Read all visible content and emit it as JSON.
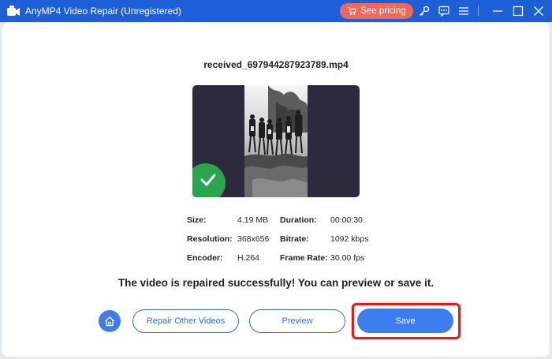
{
  "window": {
    "title": "AnyMP4 Video Repair (Unregistered)",
    "pricing_label": "See pricing"
  },
  "file": {
    "name": "received_697944287923789.mp4"
  },
  "info": {
    "size_label": "Size:",
    "size_value": "4.19 MB",
    "resolution_label": "Resolution:",
    "resolution_value": "368x656",
    "encoder_label": "Encoder:",
    "encoder_value": "H.264",
    "duration_label": "Duration:",
    "duration_value": "00:00:30",
    "bitrate_label": "Bitrate:",
    "bitrate_value": "1092 kbps",
    "framerate_label": "Frame Rate:",
    "framerate_value": "30.00 fps"
  },
  "status_message": "The video is repaired successfully! You can preview or save it.",
  "actions": {
    "repair_other_label": "Repair Other Videos",
    "preview_label": "Preview",
    "save_label": "Save"
  },
  "colors": {
    "titlebar": "#1c5fd6",
    "pricing": "#f0685a",
    "accent": "#3c7ef0",
    "success": "#2aa44e",
    "highlight": "#e11a1a"
  }
}
